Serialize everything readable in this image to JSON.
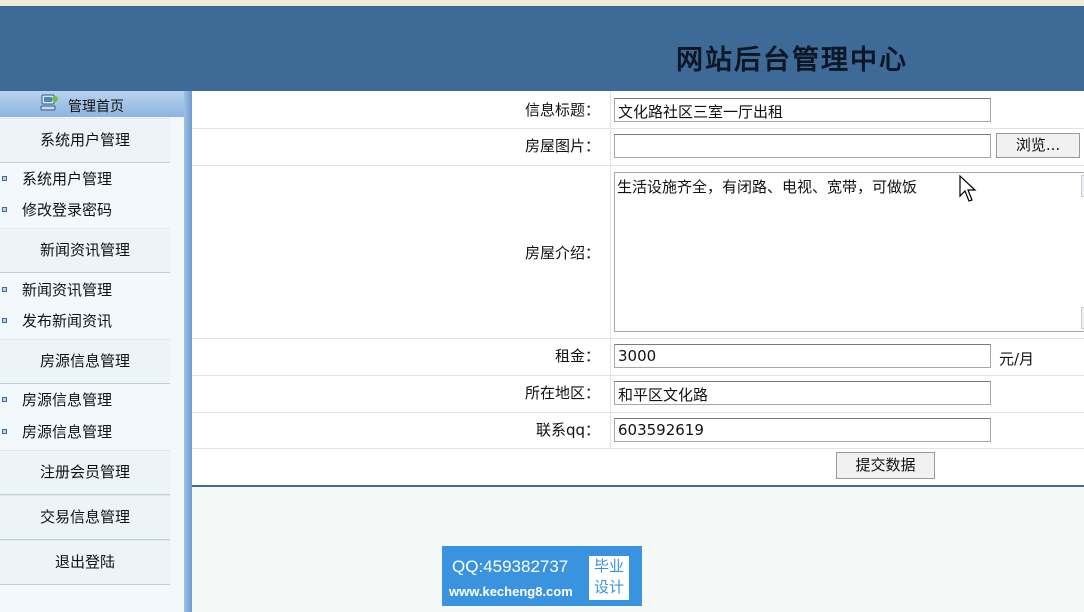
{
  "header": {
    "title": "网站后台管理中心"
  },
  "sidebar": {
    "home_label": "管理首页",
    "groups": [
      {
        "label": "系统用户管理",
        "items": [
          "系统用户管理",
          "修改登录密码"
        ]
      },
      {
        "label": "新闻资讯管理",
        "items": [
          "新闻资讯管理",
          "发布新闻资讯"
        ]
      },
      {
        "label": "房源信息管理",
        "items": [
          "房源信息管理",
          "房源信息管理"
        ]
      },
      {
        "label": "注册会员管理",
        "items": []
      },
      {
        "label": "交易信息管理",
        "items": []
      },
      {
        "label": "退出登陆",
        "items": []
      }
    ]
  },
  "form": {
    "title_label": "信息标题：",
    "title_value": "文化路社区三室一厅出租",
    "image_label": "房屋图片：",
    "image_value": "",
    "browse_label": "浏览...",
    "intro_label": "房屋介绍：",
    "intro_value": "生活设施齐全，有闭路、电视、宽带，可做饭",
    "rent_label": "租金：",
    "rent_value": "3000",
    "rent_unit": "元/月",
    "region_label": "所在地区：",
    "region_value": "和平区文化路",
    "qq_label": "联系qq：",
    "qq_value": "603592619",
    "submit_label": "提交数据"
  },
  "watermark": {
    "qq_text": "QQ:459382737",
    "url_text": "www.kecheng8.com",
    "badge_line1": "毕业",
    "badge_line2": "设计"
  }
}
